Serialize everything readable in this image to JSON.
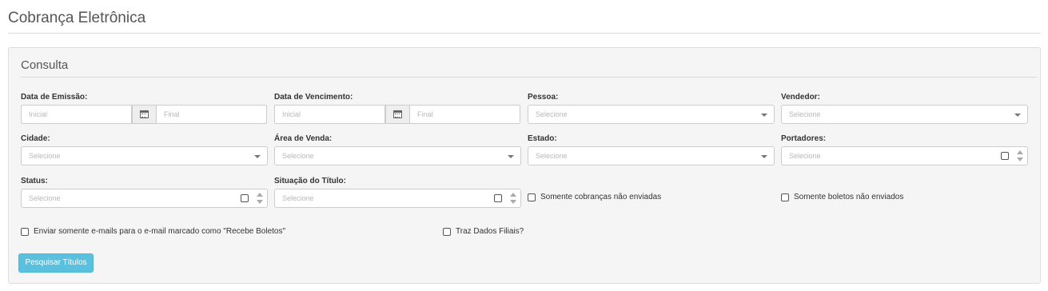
{
  "page": {
    "title": "Cobrança Eletrônica"
  },
  "consulta": {
    "title": "Consulta",
    "data_emissao": {
      "label": "Data de Emissão:",
      "initial_placeholder": "Inicial",
      "final_placeholder": "Final"
    },
    "data_vencimento": {
      "label": "Data de Vencimento:",
      "initial_placeholder": "Inicial",
      "final_placeholder": "Final"
    },
    "pessoa": {
      "label": "Pessoa:",
      "placeholder": "Selecione"
    },
    "vendedor": {
      "label": "Vendedor:",
      "placeholder": "Selecione"
    },
    "cidade": {
      "label": "Cidade:",
      "placeholder": "Selecione"
    },
    "area_venda": {
      "label": "Área de Venda:",
      "placeholder": "Selecione"
    },
    "estado": {
      "label": "Estado:",
      "placeholder": "Selecione"
    },
    "portadores": {
      "label": "Portadores:",
      "placeholder": "Selecione"
    },
    "status": {
      "label": "Status:",
      "placeholder": "Selecione"
    },
    "situacao_titulo": {
      "label": "Situação do Título:",
      "placeholder": "Selecione"
    },
    "checkboxes": {
      "somente_cobrancas": "Somente cobranças não enviadas",
      "somente_boletos": "Somente boletos não enviados",
      "enviar_somente_emails": "Enviar somente e-mails para o e-mail marcado como \"Recebe Boletos\"",
      "traz_dados_filiais": "Traz Dados Filiais?"
    },
    "search_button": "Pesquisar Títulos"
  },
  "icons": {
    "calendar": "calendar-icon",
    "dropdown": "chevron-down-icon",
    "multiselect": "checkbox-square-icon",
    "spinner": "spinner-arrows-icon"
  },
  "colors": {
    "primary_button": "#5bc0de",
    "panel_bg": "#f5f5f5"
  }
}
